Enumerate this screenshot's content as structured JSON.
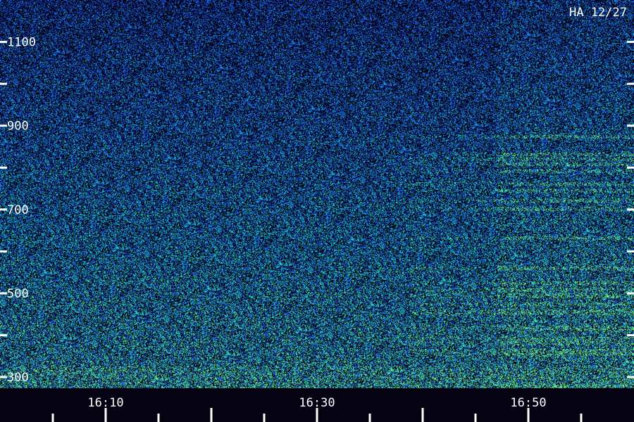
{
  "chart_data": {
    "type": "heatmap",
    "title": "HA 12/27",
    "xlabel": "",
    "ylabel": "",
    "x_ticks": [
      "16:10",
      "16:30",
      "16:50"
    ],
    "y_ticks": [
      "1100",
      "900",
      "700",
      "500",
      "300"
    ],
    "y_tick_values": [
      1100,
      900,
      700,
      500,
      300
    ],
    "ylim": [
      260,
      1200
    ],
    "xlim": [
      "16:00",
      "17:00"
    ],
    "grid": false,
    "colorscale": [
      "#000000",
      "#0a1466",
      "#1e3cc8",
      "#1a78e6",
      "#18b8d8",
      "#20e6a0",
      "#7cf070"
    ],
    "features": [
      {
        "type": "emission bands",
        "start": "16:47",
        "end": "17:00",
        "freq_range": [
          300,
          950
        ]
      }
    ]
  }
}
